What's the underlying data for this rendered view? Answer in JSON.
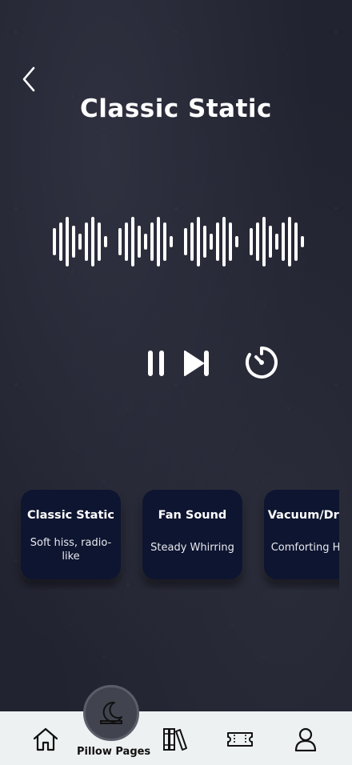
{
  "header": {
    "title": "Classic Static"
  },
  "player": {
    "state": "paused-control-shown"
  },
  "cards": [
    {
      "title": "Classic Static",
      "subtitle": "Soft hiss, radio-like"
    },
    {
      "title": "Fan Sound",
      "subtitle": "Steady Whirring"
    },
    {
      "title": "Vacuum/Dryer",
      "subtitle": "Comforting Hum"
    }
  ],
  "nav": {
    "center_label": "Pillow Pages",
    "items": [
      "home-icon",
      "moon-icon",
      "books-icon",
      "ticket-icon",
      "user-icon"
    ]
  },
  "colors": {
    "background": "#222330",
    "card": "#0e1530",
    "nav": "#eef1f1"
  }
}
